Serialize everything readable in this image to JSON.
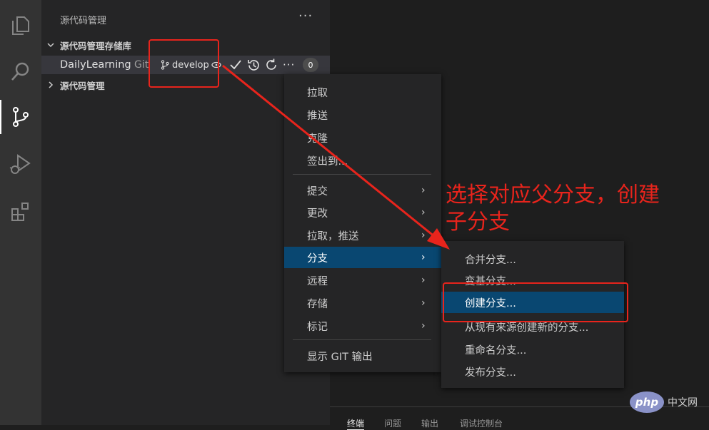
{
  "activity_bar": {
    "icons": [
      "files-icon",
      "search-icon",
      "source-control-icon",
      "run-debug-icon",
      "extensions-icon"
    ]
  },
  "sidebar": {
    "header": "源代码管理",
    "more": "···",
    "repos_section": "源代码管理存储库",
    "repo": {
      "name": "DailyLearning",
      "kind": "Git",
      "branch": "develop",
      "badge": "0"
    },
    "scm_section": "源代码管理"
  },
  "context_menu": {
    "items": [
      {
        "label": "拉取"
      },
      {
        "label": "推送"
      },
      {
        "label": "克隆"
      },
      {
        "label": "签出到..."
      },
      {
        "label": "提交",
        "arrow": "›"
      },
      {
        "label": "更改",
        "arrow": "›"
      },
      {
        "label": "拉取，推送",
        "arrow": "›"
      },
      {
        "label": "分支",
        "arrow": "›"
      },
      {
        "label": "远程",
        "arrow": "›"
      },
      {
        "label": "存储",
        "arrow": "›"
      },
      {
        "label": "标记",
        "arrow": "›"
      },
      {
        "label": "显示 GIT 输出"
      }
    ]
  },
  "branch_submenu": {
    "items": [
      {
        "label": "合并分支..."
      },
      {
        "label": "变基分支..."
      },
      {
        "label": "创建分支..."
      },
      {
        "label": "从现有来源创建新的分支..."
      },
      {
        "label": "重命名分支..."
      },
      {
        "label": "发布分支..."
      }
    ]
  },
  "panel_tabs": [
    "终端",
    "问题",
    "输出",
    "调试控制台"
  ],
  "annotation": {
    "text": "选择对应父分支，创建子分支",
    "color": "#e8241c"
  },
  "watermark": {
    "logo": "php",
    "text": "中文网"
  },
  "colors": {
    "selection": "#094771",
    "activity_bar": "#333333",
    "sidebar": "#252526"
  }
}
